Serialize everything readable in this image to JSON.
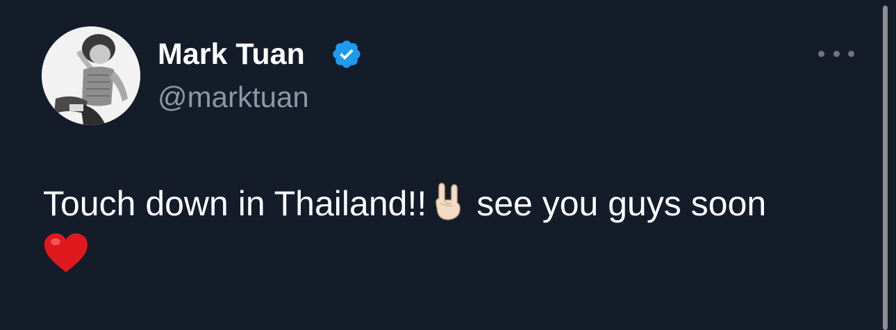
{
  "author": {
    "display_name": "Mark Tuan",
    "handle": "@marktuan",
    "verified": true,
    "avatar": "profile-photo-black-and-white"
  },
  "tweet": {
    "text_line1": "Touch down in Thailand!!",
    "emoji_hand": "🤘🏻",
    "text_line1_end": "see you guys soon",
    "emoji_heart": "❤️"
  },
  "icons": {
    "verified": "verified-badge-icon",
    "more": "more-options-icon"
  },
  "colors": {
    "background": "#151c29",
    "name": "#ffffff",
    "handle": "#8b98a5",
    "verified": "#1d9bf0",
    "heart": "#e0191f"
  }
}
